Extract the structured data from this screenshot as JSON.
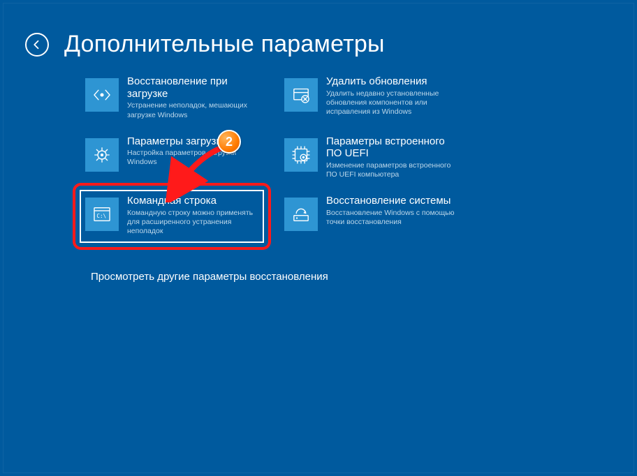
{
  "page": {
    "title": "Дополнительные параметры",
    "more_link": "Просмотреть другие параметры восстановления"
  },
  "tiles": {
    "startup_repair": {
      "title": "Восстановление при загрузке",
      "desc": "Устранение неполадок, мешающих загрузке Windows",
      "icon": "code-icon"
    },
    "uninstall_updates": {
      "title": "Удалить обновления",
      "desc": "Удалить недавно установленные обновления компонентов или исправления из Windows",
      "icon": "package-remove-icon"
    },
    "startup_settings": {
      "title": "Параметры загрузки",
      "desc": "Настройка параметров загрузки Windows",
      "icon": "gear-icon"
    },
    "uefi_firmware": {
      "title": "Параметры встроенного ПО UEFI",
      "desc": "Изменение параметров встроенного ПО UEFI компьютера",
      "icon": "chip-gear-icon"
    },
    "command_prompt": {
      "title": "Командная строка",
      "desc": "Командную строку можно применять для расширенного устранения неполадок",
      "icon": "terminal-icon"
    },
    "system_restore": {
      "title": "Восстановление системы",
      "desc": "Восстановление Windows с помощью точки восстановления",
      "icon": "hdd-icon"
    }
  },
  "annotation": {
    "badge_number": "2"
  }
}
